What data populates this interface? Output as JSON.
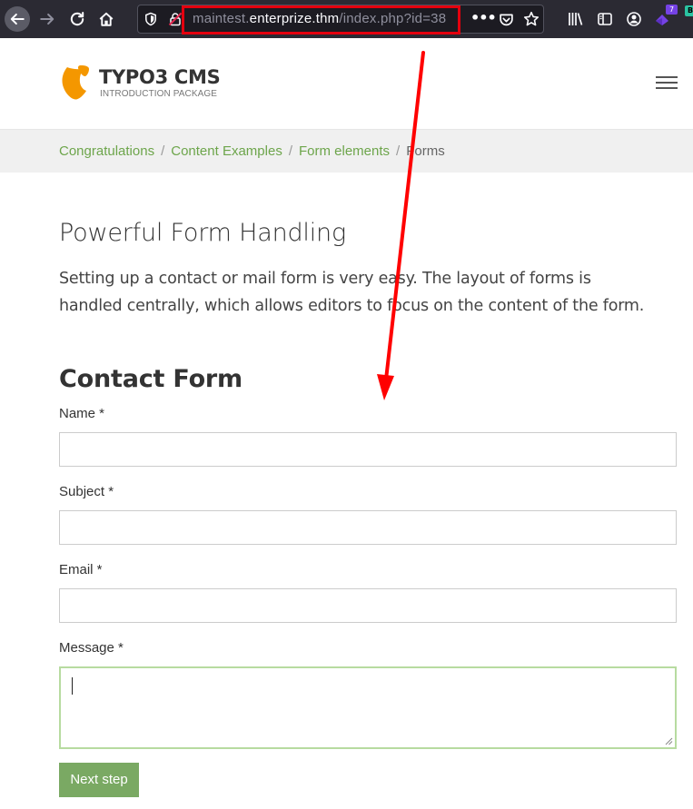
{
  "browser": {
    "url_subdomain": "maintest.",
    "url_host": "enterprize.thm",
    "url_path": "/index.php?id=38",
    "url_more": "•••",
    "extension_badge": "7",
    "extension2_badge": "B",
    "icons": [
      "back-icon",
      "forward-icon",
      "reload-icon",
      "home-icon",
      "shield-icon",
      "insecure-lock-icon",
      "page-actions-icon",
      "pocket-icon",
      "bookmark-star-icon",
      "library-icon",
      "sidebar-icon",
      "account-icon",
      "extension-icon"
    ],
    "highlight_color": "#e4000e"
  },
  "site": {
    "logo_title": "TYPO3 CMS",
    "logo_subtitle": "INTRODUCTION PACKAGE",
    "brand_color": "#f49700",
    "menu_icon": "hamburger-icon"
  },
  "breadcrumb": {
    "items": [
      "Congratulations",
      "Content Examples",
      "Form elements"
    ],
    "current": "Forms",
    "separator": "/",
    "link_color": "#6da54b"
  },
  "content": {
    "title": "Powerful Form Handling",
    "lead": "Setting up a contact or mail form is very easy. The layout of forms is handled centrally, which allows editors to focus on the content of the form.",
    "form_title": "Contact Form"
  },
  "form": {
    "fields": [
      {
        "label": "Name *",
        "value": ""
      },
      {
        "label": "Subject *",
        "value": ""
      },
      {
        "label": "Email *",
        "value": ""
      },
      {
        "label": "Message *",
        "value": ""
      }
    ],
    "submit_label": "Next step",
    "button_color": "#7aa963",
    "focus_border_color": "#b7dba0"
  },
  "annotation": {
    "arrow_color": "#ff0000"
  }
}
